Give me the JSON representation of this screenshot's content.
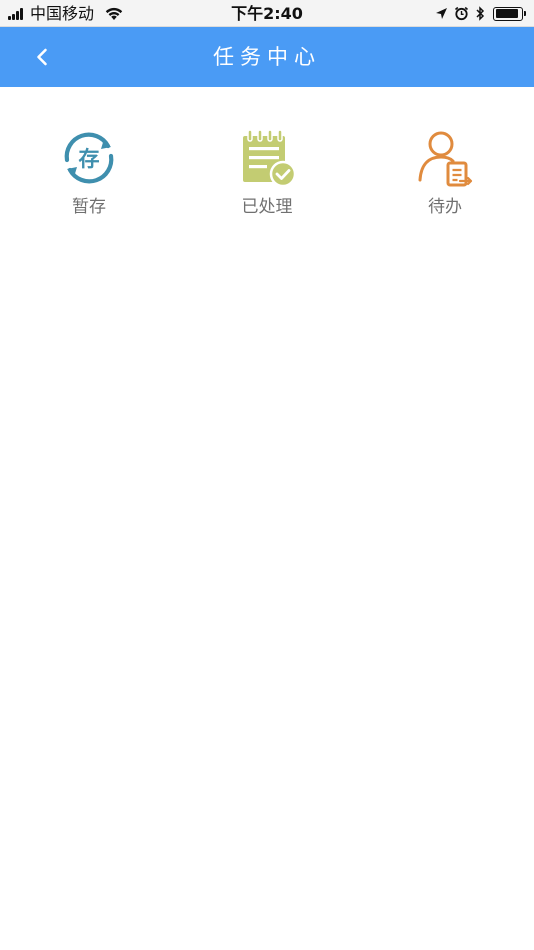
{
  "status_bar": {
    "carrier": "中国移动",
    "time": "下午2:40",
    "battery_level": 0.9
  },
  "nav": {
    "title": "任务中心"
  },
  "grid": {
    "items": [
      {
        "label": "暂存",
        "icon": "save-draft-icon",
        "color": "#3f8fae",
        "icon_text": "存"
      },
      {
        "label": "已处理",
        "icon": "processed-notepad-icon",
        "color": "#c3cc72"
      },
      {
        "label": "待办",
        "icon": "todo-user-icon",
        "color": "#e08b3e"
      }
    ]
  }
}
